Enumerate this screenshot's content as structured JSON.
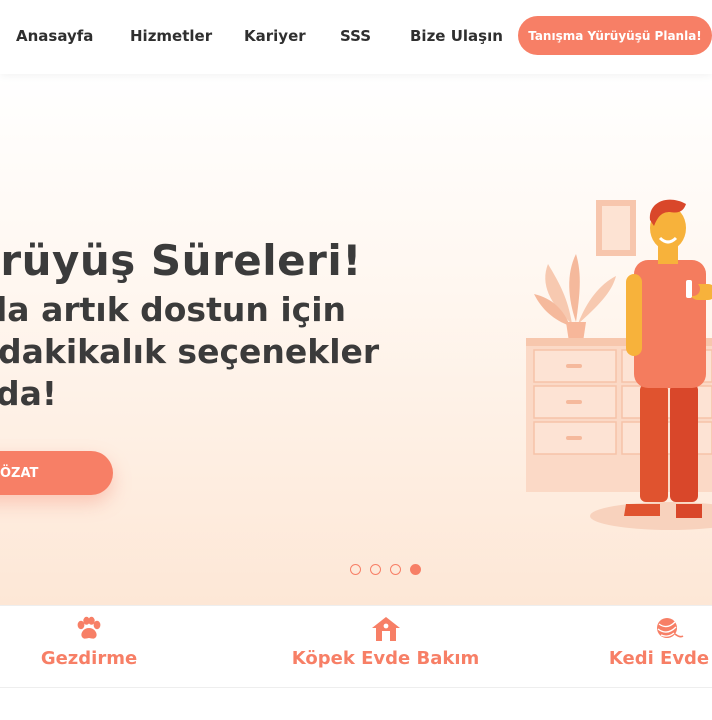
{
  "nav": {
    "items": [
      "Anasayfa",
      "Hizmetler",
      "Kariyer",
      "SSS",
      "Bize Ulaşın"
    ],
    "cta": "Tanışma Yürüyüşü Planla!"
  },
  "hero": {
    "title": "ürüyüş Süreleri!",
    "lines": [
      "la artık dostun için",
      "dakikalık seçenekler",
      "da!"
    ],
    "button": "ÖZAT",
    "slides": {
      "count": 4,
      "active": 4
    }
  },
  "services": [
    {
      "label": "Gezdirme",
      "icon": "paw-icon"
    },
    {
      "label": "Köpek Evde Bakım",
      "icon": "house-icon"
    },
    {
      "label": "Kedi Evde B",
      "icon": "yarn-ball-icon"
    }
  ],
  "colors": {
    "accent": "#f77f66",
    "text": "#3b3b3b"
  }
}
